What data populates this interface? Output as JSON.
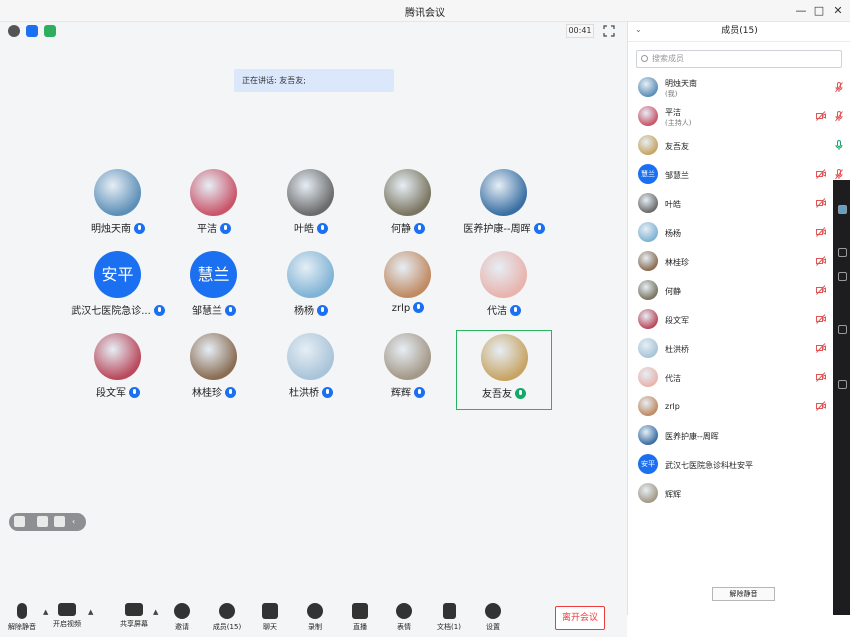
{
  "window": {
    "title": "腾讯会议"
  },
  "status": {
    "timer": "00:41"
  },
  "speaking": {
    "text": "正在讲话: 友吾友;"
  },
  "grid": [
    {
      "name": "明烛天南",
      "avatar_text": "",
      "active": false
    },
    {
      "name": "平洁",
      "avatar_text": "",
      "active": false
    },
    {
      "name": "叶皓",
      "avatar_text": "",
      "active": false
    },
    {
      "name": "何静",
      "avatar_text": "",
      "active": false
    },
    {
      "name": "医养护康--周晖",
      "avatar_text": "",
      "active": false
    },
    {
      "name": "武汉七医院急诊...",
      "avatar_text": "安平",
      "active": false
    },
    {
      "name": "邹慧兰",
      "avatar_text": "慧兰",
      "active": false
    },
    {
      "name": "杨杨",
      "avatar_text": "",
      "active": false
    },
    {
      "name": "zrlp",
      "avatar_text": "",
      "active": false
    },
    {
      "name": "代洁",
      "avatar_text": "",
      "active": false
    },
    {
      "name": "段文军",
      "avatar_text": "",
      "active": false
    },
    {
      "name": "林桂珍",
      "avatar_text": "",
      "active": false
    },
    {
      "name": "杜洪桥",
      "avatar_text": "",
      "active": false
    },
    {
      "name": "辉辉",
      "avatar_text": "",
      "active": false
    },
    {
      "name": "友吾友",
      "avatar_text": "",
      "active": true
    }
  ],
  "toolbar": {
    "unmute": "解除静音",
    "video": "开启视频",
    "share": "共享屏幕",
    "invite": "邀请",
    "members": "成员(15)",
    "chat": "聊天",
    "record": "录制",
    "live": "直播",
    "reactions": "表情",
    "docs": "文档(1)",
    "settings": "设置",
    "leave": "离开会议"
  },
  "panel": {
    "title": "成员(15)",
    "search_placeholder": "搜索成员",
    "unmute_all": "解除静音",
    "members": [
      {
        "name": "明烛天南",
        "sub": "(我)",
        "avatar_text": ""
      },
      {
        "name": "平洁",
        "sub": "(主持人)",
        "avatar_text": ""
      },
      {
        "name": "友吾友",
        "sub": "",
        "avatar_text": ""
      },
      {
        "name": "邹慧兰",
        "sub": "",
        "avatar_text": "慧兰"
      },
      {
        "name": "叶皓",
        "sub": "",
        "avatar_text": ""
      },
      {
        "name": "杨杨",
        "sub": "",
        "avatar_text": ""
      },
      {
        "name": "林桂珍",
        "sub": "",
        "avatar_text": ""
      },
      {
        "name": "何静",
        "sub": "",
        "avatar_text": ""
      },
      {
        "name": "段文军",
        "sub": "",
        "avatar_text": ""
      },
      {
        "name": "杜洪桥",
        "sub": "",
        "avatar_text": ""
      },
      {
        "name": "代洁",
        "sub": "",
        "avatar_text": ""
      },
      {
        "name": "zrlp",
        "sub": "",
        "avatar_text": ""
      },
      {
        "name": "医养护康--周晖",
        "sub": "",
        "avatar_text": ""
      },
      {
        "name": "武汉七医院急诊科杜安平",
        "sub": "",
        "avatar_text": "安平"
      },
      {
        "name": "辉辉",
        "sub": "",
        "avatar_text": ""
      }
    ]
  },
  "colors": {
    "accent": "#1b70f1",
    "leave": "#ee3b3b",
    "active_border": "#2ab462",
    "muted_icon": "#e05555",
    "speaking_icon": "#14a86a"
  }
}
